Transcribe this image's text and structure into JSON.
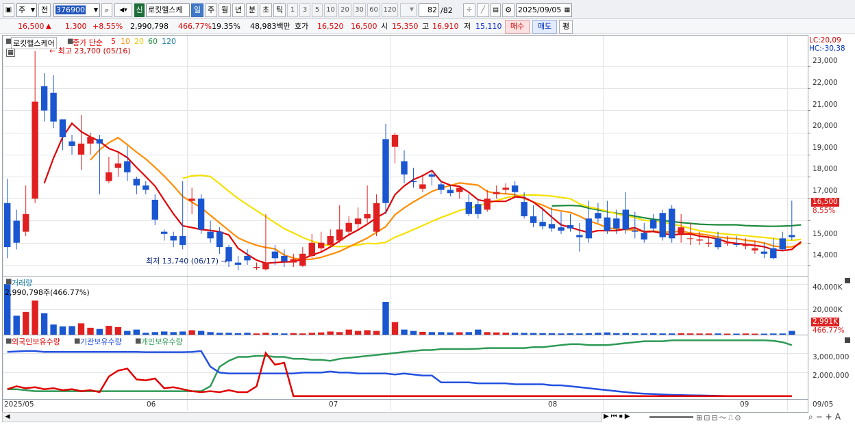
{
  "toolbar": {
    "market": "주",
    "prev_label": "전",
    "code": "376900",
    "new_badge": "신",
    "stock_name": "로킷헬스케",
    "periods": [
      "일",
      "주",
      "월",
      "년",
      "분",
      "초",
      "틱"
    ],
    "active_period": "일",
    "intervals": [
      "1",
      "3",
      "5",
      "10",
      "20",
      "30",
      "60",
      "120"
    ],
    "count": "82",
    "count_total": "/82",
    "date": "2025/09/05"
  },
  "quote": {
    "price": "16,500",
    "arrow": "▲",
    "change": "1,300",
    "change_pct": "+8.55%",
    "volume": "2,990,798",
    "volume_ratio": "466.77%",
    "turnover_pct": "19.35%",
    "amount": "48,983백만",
    "ask_label": "호가",
    "ask1": "16,520",
    "ask2": "16,500",
    "open_label": "시",
    "open": "15,350",
    "high_label": "고",
    "high": "16,910",
    "low_label": "저",
    "low": "15,110",
    "buy_label": "매수",
    "sell_label": "매도",
    "avg_label": "평"
  },
  "price_panel": {
    "legend_name": "로킷헬스케어",
    "legend_ma_title": "종가 단순",
    "legend_ma": [
      "5",
      "10",
      "20",
      "60",
      "120"
    ],
    "max_label": "최고 23,700 (05/16)",
    "min_label": "최저 13,740 (06/17)",
    "lc": "LC:20,09",
    "hc": "HC:-30,38",
    "y_ticks": [
      "23,000",
      "22,000",
      "21,000",
      "20,000",
      "19,000",
      "18,000",
      "17,000",
      "15,000",
      "14,000"
    ],
    "price_tag": "16,500",
    "pct_tag": "8.55%"
  },
  "volume_panel": {
    "title": "거래량",
    "value_label": "2,990,798주(466.77%)",
    "y_ticks": [
      "40,000K",
      "20,000K"
    ],
    "vol_tag": "2,991K",
    "pct_tag": "466.77%"
  },
  "holding_panel": {
    "series": [
      "외국인보유수량",
      "기관보유수량",
      "개인보유수량"
    ],
    "y_ticks": [
      "3,000,000",
      "2,000,000"
    ]
  },
  "x_axis": {
    "labels": [
      "2025/05",
      "06",
      "07",
      "08",
      "09"
    ],
    "right_label": "09/05"
  },
  "colors": {
    "up": "#e02020",
    "down": "#1a56d0",
    "ma5": "#e00000",
    "ma10": "#ff8c00",
    "ma20": "#f5e100",
    "ma60": "#1a8a3a",
    "foreign": "#e00000",
    "institution": "#2350e0",
    "individual": "#2e9a55"
  },
  "chart_data": {
    "type": "candlestick",
    "x": [
      "05/02",
      "05/07",
      "05/08",
      "05/09",
      "05/12",
      "05/13",
      "05/14",
      "05/15",
      "05/16",
      "05/19",
      "05/20",
      "05/21",
      "05/22",
      "05/23",
      "05/26",
      "05/27",
      "05/28",
      "05/29",
      "05/30",
      "06/02",
      "06/04",
      "06/05",
      "06/09",
      "06/10",
      "06/11",
      "06/12",
      "06/13",
      "06/16",
      "06/17",
      "06/18",
      "06/19",
      "06/20",
      "06/23",
      "06/24",
      "06/25",
      "06/26",
      "06/27",
      "06/30",
      "07/01",
      "07/02",
      "07/03",
      "07/04",
      "07/07",
      "07/08",
      "07/09",
      "07/10",
      "07/11",
      "07/14",
      "07/15",
      "07/16",
      "07/17",
      "07/18",
      "07/21",
      "07/22",
      "07/23",
      "07/24",
      "07/25",
      "07/28",
      "07/29",
      "07/30",
      "07/31",
      "08/01",
      "08/04",
      "08/05",
      "08/06",
      "08/07",
      "08/08",
      "08/11",
      "08/12",
      "08/13",
      "08/14",
      "08/18",
      "08/19",
      "08/20",
      "08/21",
      "08/22",
      "08/25",
      "08/26",
      "08/27",
      "08/28",
      "08/29",
      "09/01",
      "09/02",
      "09/03",
      "09/04",
      "09/05"
    ],
    "open": [
      16800,
      16000,
      15500,
      17000,
      22100,
      21800,
      20600,
      19600,
      19000,
      19500,
      19700,
      17800,
      18400,
      18700,
      17900,
      17600,
      16950,
      15500,
      15300,
      15300,
      16900,
      17000,
      15500,
      15500,
      14800,
      14100,
      14400,
      13850,
      13800,
      14600,
      14400,
      14100,
      13950,
      14400,
      14750,
      14900,
      15100,
      15500,
      15850,
      16100,
      15500,
      19700,
      19350,
      18700,
      17800,
      17450,
      18100,
      17650,
      17400,
      17300,
      16850,
      16750,
      16500,
      17200,
      17400,
      17600,
      16850,
      16200,
      15950,
      15850,
      15700,
      15800,
      15350,
      16100,
      16350,
      16150,
      16100,
      16500,
      15550,
      15450,
      16050,
      16350,
      16550,
      15400,
      15200,
      15100,
      14950,
      15200,
      15000,
      14950,
      14850,
      14650,
      14600,
      14750,
      15200,
      15350
    ],
    "close": [
      14800,
      15000,
      16300,
      21400,
      21000,
      20500,
      19800,
      19400,
      19500,
      19800,
      19500,
      18200,
      18600,
      18200,
      17600,
      17400,
      16050,
      15400,
      15100,
      14900,
      17000,
      15600,
      15200,
      14800,
      14150,
      14000,
      14200,
      13900,
      14100,
      14300,
      14150,
      14250,
      14500,
      15000,
      15000,
      15300,
      15600,
      15900,
      16100,
      16300,
      16800,
      16800,
      19900,
      18100,
      17750,
      17650,
      18000,
      17400,
      17250,
      17500,
      16300,
      16300,
      17000,
      17300,
      17500,
      17300,
      16200,
      15900,
      15750,
      15650,
      15550,
      15650,
      15250,
      15200,
      16100,
      15550,
      15650,
      15600,
      15500,
      15150,
      15650,
      15250,
      15200,
      15700,
      15200,
      15150,
      15000,
      14800,
      15000,
      14900,
      14950,
      14750,
      14500,
      14300,
      14700,
      15250,
      16500
    ],
    "high": [
      17900,
      16500,
      17600,
      23700,
      22700,
      22600,
      20600,
      19900,
      20800,
      20000,
      19900,
      18900,
      19100,
      19400,
      18000,
      17800,
      17200,
      15600,
      15500,
      17800,
      17500,
      17200,
      16000,
      15700,
      14900,
      14400,
      14700,
      14100,
      16300,
      14900,
      14700,
      14500,
      14800,
      15400,
      15500,
      15600,
      16700,
      16200,
      16600,
      17600,
      17200,
      20400,
      20000,
      19200,
      18400,
      18100,
      18300,
      17800,
      17600,
      17600,
      17200,
      17000,
      17400,
      17600,
      17700,
      17800,
      17300,
      16700,
      16500,
      16600,
      16400,
      16300,
      15900,
      16900,
      16800,
      16900,
      16500,
      17300,
      16400,
      15900,
      16300,
      16500,
      16700,
      16300,
      15900,
      15500,
      15300,
      15500,
      15300,
      15300,
      15200,
      15100,
      15000,
      15200,
      15500,
      16910
    ],
    "low": [
      14300,
      14700,
      15300,
      16800,
      20500,
      20200,
      19200,
      19000,
      18300,
      19000,
      17200,
      17700,
      18000,
      17800,
      17200,
      17200,
      15800,
      15100,
      14800,
      14700,
      16300,
      15400,
      15000,
      14500,
      13900,
      13740,
      14000,
      13760,
      13740,
      14000,
      13900,
      13900,
      13900,
      14300,
      14600,
      14800,
      15000,
      15300,
      15600,
      15900,
      15300,
      16300,
      18600,
      17700,
      17500,
      17300,
      17600,
      17200,
      17100,
      17000,
      16200,
      16100,
      16400,
      17000,
      17200,
      17100,
      16100,
      15700,
      15600,
      15500,
      15400,
      15500,
      14600,
      15000,
      15900,
      15400,
      15400,
      15400,
      15200,
      15000,
      15500,
      15100,
      15000,
      15000,
      14900,
      14900,
      14800,
      14700,
      14850,
      14800,
      14700,
      14500,
      14300,
      14250,
      14650,
      15110
    ],
    "volume_k": [
      40000,
      15000,
      18000,
      27000,
      17000,
      8000,
      6500,
      6800,
      9000,
      5500,
      4500,
      7000,
      6000,
      3000,
      4000,
      1500,
      2000,
      2500,
      2000,
      2500,
      3500,
      3000,
      2000,
      1500,
      1500,
      1200,
      1500,
      1000,
      1500,
      1200,
      1000,
      1200,
      1000,
      1500,
      1800,
      2500,
      2000,
      4000,
      3000,
      3500,
      3000,
      26000,
      10000,
      4000,
      3000,
      2200,
      2000,
      2000,
      1800,
      1900,
      2000,
      4000,
      2000,
      1800,
      1600,
      1500,
      1400,
      1300,
      1200,
      1100,
      1000,
      1100,
      1000,
      1200,
      1500,
      1800,
      1200,
      1300,
      1100,
      1000,
      1200,
      1000,
      1000,
      1100,
      1000,
      900,
      900,
      1000,
      800,
      800,
      900,
      800,
      800,
      900,
      900,
      2991
    ],
    "foreign_holding": [
      1150000,
      1300000,
      1200000,
      1250000,
      1150000,
      1200000,
      1100000,
      1150000,
      1050000,
      1100000,
      1000000,
      1800000,
      2100000,
      2200000,
      1650000,
      1600000,
      1700000,
      1200000,
      1250000,
      1150000,
      1050000,
      1000000,
      1050000,
      1000000,
      1100000,
      1000000,
      1000000,
      1300000,
      3000000,
      2400000,
      2500000,
      800000,
      800000,
      800000,
      800000,
      800000,
      800000,
      800000,
      800000,
      800000,
      800000,
      800000,
      800000,
      800000,
      800000,
      800000,
      800000,
      800000,
      800000,
      800000,
      800000,
      800000,
      800000,
      800000,
      800000,
      800000,
      800000,
      800000,
      800000,
      800000,
      800000,
      800000,
      800000,
      800000,
      800000,
      800000,
      800000,
      800000,
      800000,
      800000,
      800000,
      800000,
      800000,
      800000,
      800000,
      800000,
      800000,
      800000,
      800000,
      800000,
      800000,
      800000,
      800000,
      800000,
      800000,
      800000
    ],
    "institution_holding": [
      3050000,
      3080000,
      3100000,
      3100000,
      3050000,
      3050000,
      3050000,
      3050000,
      3050000,
      3050000,
      3050000,
      3050000,
      3050000,
      3050000,
      3050000,
      3040000,
      3040000,
      3040000,
      3040000,
      3040000,
      3050000,
      3100000,
      2300000,
      2000000,
      1950000,
      1950000,
      1950000,
      1950000,
      1950000,
      1950000,
      1950000,
      1950000,
      2000000,
      2000000,
      2000000,
      2050000,
      2000000,
      2000000,
      1950000,
      1950000,
      1950000,
      1950000,
      1900000,
      1950000,
      1900000,
      1850000,
      1850000,
      1500000,
      1500000,
      1500000,
      1500000,
      1450000,
      1450000,
      1450000,
      1450000,
      1400000,
      1400000,
      1400000,
      1400000,
      1350000,
      1350000,
      1300000,
      1250000,
      1200000,
      1150000,
      1100000,
      1050000,
      1000000,
      950000,
      920000,
      900000,
      880000,
      860000,
      850000,
      840000,
      830000,
      820000,
      810000,
      800000,
      800000,
      800000,
      800000,
      800000,
      800000,
      800000,
      800000
    ],
    "individual_holding": [
      1150000,
      1150000,
      1100000,
      1050000,
      1050000,
      1050000,
      1050000,
      1050000,
      1050000,
      1050000,
      1050000,
      1050000,
      1050000,
      1050000,
      1050000,
      1050000,
      1050000,
      1050000,
      1050000,
      1050000,
      1050000,
      1050000,
      1300000,
      2300000,
      2600000,
      2800000,
      2800000,
      2850000,
      2850000,
      2800000,
      2800000,
      2700000,
      2700000,
      2650000,
      2650000,
      2600000,
      2700000,
      2750000,
      2800000,
      2850000,
      2900000,
      2950000,
      3000000,
      3050000,
      3100000,
      3150000,
      3150000,
      3200000,
      3200000,
      3200000,
      3200000,
      3220000,
      3250000,
      3250000,
      3250000,
      3250000,
      3250000,
      3300000,
      3300000,
      3350000,
      3400000,
      3450000,
      3450000,
      3400000,
      3400000,
      3400000,
      3450000,
      3500000,
      3550000,
      3600000,
      3600000,
      3600000,
      3650000,
      3650000,
      3650000,
      3650000,
      3650000,
      3650000,
      3650000,
      3650000,
      3650000,
      3650000,
      3650000,
      3620000,
      3550000,
      3400000
    ],
    "y_range": [
      13500,
      24400
    ],
    "volume_range_k": [
      0,
      45000
    ],
    "holding_range": [
      650000,
      3900000
    ]
  }
}
